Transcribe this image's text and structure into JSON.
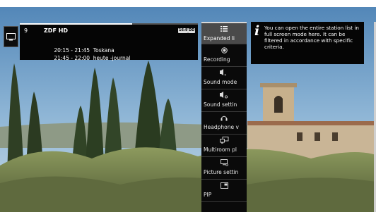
{
  "info_bar": {
    "channel_number": "9",
    "channel_name": "ZDF HD",
    "tags": [
      "16:9",
      "DD"
    ],
    "programs": [
      {
        "time": "20:15 - 21:45",
        "title": "Toskana"
      },
      {
        "time": "21:45 - 22:00",
        "title": "heute -journal"
      }
    ],
    "progress": 0.63
  },
  "menu": {
    "items": [
      {
        "label": "Expanded li",
        "icon": "list-icon",
        "active": true
      },
      {
        "label": "Recording",
        "icon": "record-icon",
        "active": false
      },
      {
        "label": "Sound mode",
        "icon": "sound-mode-icon",
        "active": false
      },
      {
        "label": "Sound settin",
        "icon": "sound-settings-icon",
        "active": false
      },
      {
        "label": "Headphone v",
        "icon": "headphone-icon",
        "active": false
      },
      {
        "label": "Multiroom pl",
        "icon": "multiroom-icon",
        "active": false
      },
      {
        "label": "Picture settin",
        "icon": "picture-settings-icon",
        "active": false
      },
      {
        "label": "PIP",
        "icon": "pip-icon",
        "active": false
      }
    ]
  },
  "tooltip": {
    "icon": "info-icon",
    "text": "You can open the entire station list in full screen mode here. It can be filtered in accordance with specific criteria."
  },
  "colors": {
    "panel_bg": "#050505",
    "menu_active_bg": "#4a4a4a",
    "text": "#ffffff"
  }
}
